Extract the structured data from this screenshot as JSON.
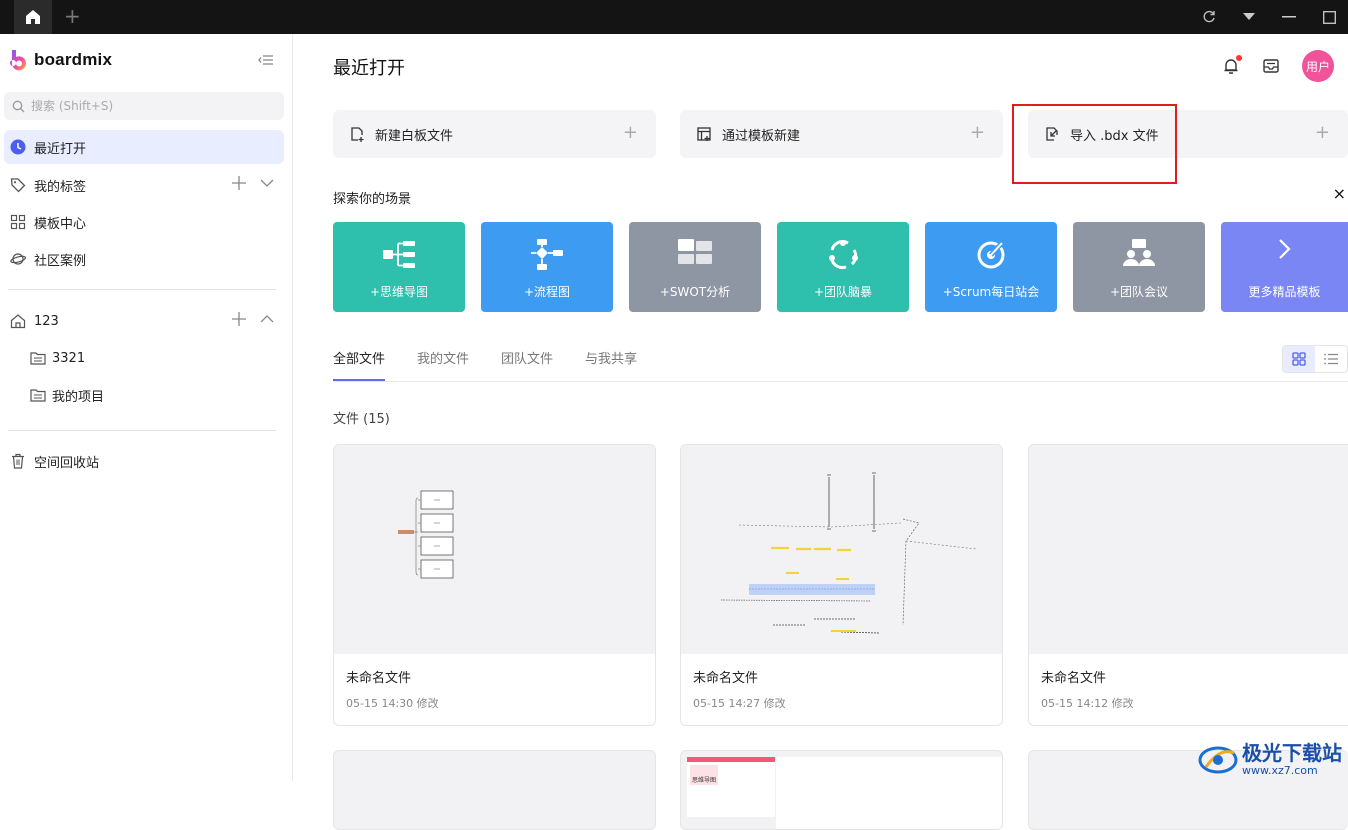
{
  "titlebar": {
    "new_tab": "+"
  },
  "sidebar": {
    "brand": "boardmix",
    "search_placeholder": "搜索 (Shift+S)",
    "items": [
      {
        "label": "最近打开"
      },
      {
        "label": "我的标签"
      },
      {
        "label": "模板中心"
      },
      {
        "label": "社区案例"
      }
    ],
    "space": {
      "label": "123",
      "children": [
        {
          "label": "3321"
        },
        {
          "label": "我的项目"
        }
      ]
    },
    "trash": "空间回收站"
  },
  "header": {
    "title": "最近打开",
    "avatar": "用户"
  },
  "actions": [
    {
      "label": "新建白板文件"
    },
    {
      "label": "通过模板新建"
    },
    {
      "label": "导入 .bdx 文件"
    }
  ],
  "scenes": {
    "title": "探索你的场景",
    "close": "×",
    "items": [
      {
        "label": "+思维导图",
        "color": "#2fbfad"
      },
      {
        "label": "+流程图",
        "color": "#3d9bf2"
      },
      {
        "label": "+SWOT分析",
        "color": "#8e95a3"
      },
      {
        "label": "+团队脑暴",
        "color": "#2fbfad"
      },
      {
        "label": "+Scrum每日站会",
        "color": "#3d9bf2"
      },
      {
        "label": "+团队会议",
        "color": "#8e95a3"
      },
      {
        "label": "更多精品模板",
        "color": "#7b86f5"
      }
    ]
  },
  "tabs": [
    {
      "label": "全部文件"
    },
    {
      "label": "我的文件"
    },
    {
      "label": "团队文件"
    },
    {
      "label": "与我共享"
    }
  ],
  "files": {
    "label": "文件 (15)",
    "items": [
      {
        "name": "未命名文件",
        "time": "05-15 14:30 修改"
      },
      {
        "name": "未命名文件",
        "time": "05-15 14:27 修改"
      },
      {
        "name": "未命名文件",
        "time": "05-15 14:12 修改"
      }
    ],
    "partial_thumb_label": "思维导图"
  },
  "watermark": {
    "text": "极光下载站",
    "url": "www.xz7.com"
  }
}
